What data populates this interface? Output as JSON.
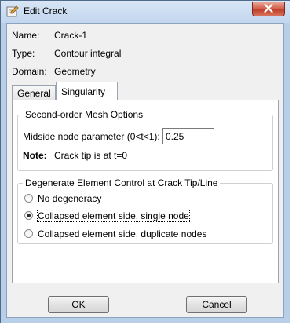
{
  "window": {
    "title": "Edit Crack",
    "icon": "pencil-edit-icon",
    "close_icon": "close-x-icon",
    "close_button_color": "#c9432c"
  },
  "info": {
    "name_label": "Name:",
    "name_value": "Crack-1",
    "type_label": "Type:",
    "type_value": "Contour integral",
    "domain_label": "Domain:",
    "domain_value": "Geometry"
  },
  "tabs": [
    {
      "label": "General",
      "active": false
    },
    {
      "label": "Singularity",
      "active": true
    }
  ],
  "mesh_options": {
    "title": "Second-order Mesh Options",
    "midside_label": "Midside node parameter (0<t<1):",
    "midside_value": "0.25",
    "note_label": "Note:",
    "note_text": "Crack tip is at t=0"
  },
  "degenerate": {
    "title": "Degenerate Element Control at Crack Tip/Line",
    "options": [
      {
        "label": "No degeneracy",
        "selected": false
      },
      {
        "label": "Collapsed element side, single node",
        "selected": true
      },
      {
        "label": "Collapsed element side, duplicate nodes",
        "selected": false
      }
    ]
  },
  "buttons": {
    "ok": "OK",
    "cancel": "Cancel"
  }
}
